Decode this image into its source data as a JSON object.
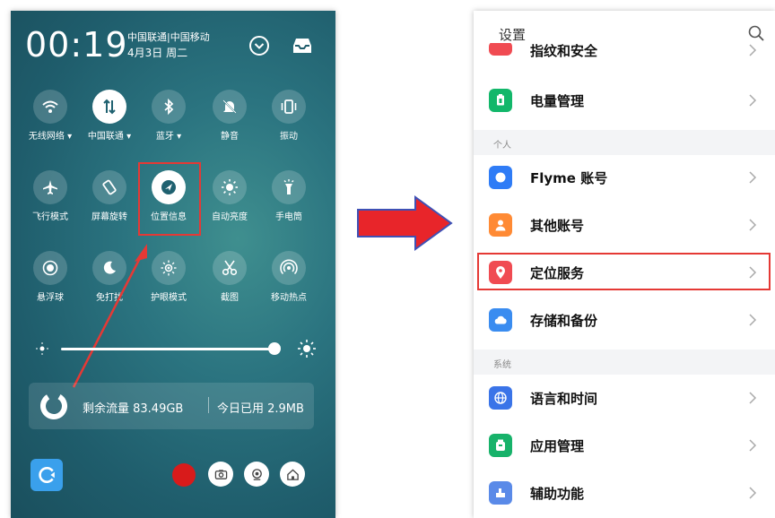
{
  "left_panel": {
    "time": "00:19",
    "carrier": "中国联通|中国移动",
    "date": "4月3日 周二",
    "tiles": [
      {
        "label": "无线网络 ▾",
        "icon": "wifi-icon",
        "active": false
      },
      {
        "label": "中国联通 ▾",
        "icon": "mobile-data-icon",
        "active": true
      },
      {
        "label": "蓝牙 ▾",
        "icon": "bluetooth-icon",
        "active": false
      },
      {
        "label": "静音",
        "icon": "mute-icon",
        "active": false
      },
      {
        "label": "振动",
        "icon": "vibrate-icon",
        "active": false
      },
      {
        "label": "飞行模式",
        "icon": "airplane-icon",
        "active": false
      },
      {
        "label": "屏幕旋转",
        "icon": "rotate-icon",
        "active": false
      },
      {
        "label": "位置信息",
        "icon": "location-icon",
        "active": true
      },
      {
        "label": "自动亮度",
        "icon": "auto-brightness-icon",
        "active": false
      },
      {
        "label": "手电筒",
        "icon": "flashlight-icon",
        "active": false
      },
      {
        "label": "悬浮球",
        "icon": "floating-ball-icon",
        "active": false
      },
      {
        "label": "免打扰",
        "icon": "do-not-disturb-icon",
        "active": false
      },
      {
        "label": "护眼模式",
        "icon": "eye-care-icon",
        "active": false
      },
      {
        "label": "截图",
        "icon": "screenshot-icon",
        "active": false
      },
      {
        "label": "移动热点",
        "icon": "hotspot-icon",
        "active": false
      }
    ],
    "brightness_level": 0.98,
    "traffic_remaining": "剩余流量 83.49GB",
    "traffic_today": "今日已用 2.9MB"
  },
  "right_panel": {
    "title": "设置",
    "partial_item": "指纹和安全",
    "items_top": [
      {
        "label": "电量管理",
        "icon": "battery-icon",
        "color": "#12b76a"
      }
    ],
    "section_personal": "个人",
    "items_personal": [
      {
        "label": "Flyme 账号",
        "icon": "flyme-account-icon",
        "color": "#2f7cf6"
      },
      {
        "label": "其他账号",
        "icon": "account-icon",
        "color": "#ff8a34"
      },
      {
        "label": "定位服务",
        "icon": "location-service-icon",
        "color": "#f04b52"
      },
      {
        "label": "存储和备份",
        "icon": "cloud-icon",
        "color": "#3a8cf0"
      }
    ],
    "section_system": "系统",
    "items_system": [
      {
        "label": "语言和时间",
        "icon": "globe-icon",
        "color": "#3a74e8"
      },
      {
        "label": "应用管理",
        "icon": "app-manager-icon",
        "color": "#17b26a"
      },
      {
        "label": "辅助功能",
        "icon": "accessibility-icon",
        "color": "#5a8ae8"
      }
    ]
  },
  "colors": {
    "highlight": "#e53935",
    "arrow_fill": "#e8252a",
    "arrow_outline": "#3f51b5"
  }
}
